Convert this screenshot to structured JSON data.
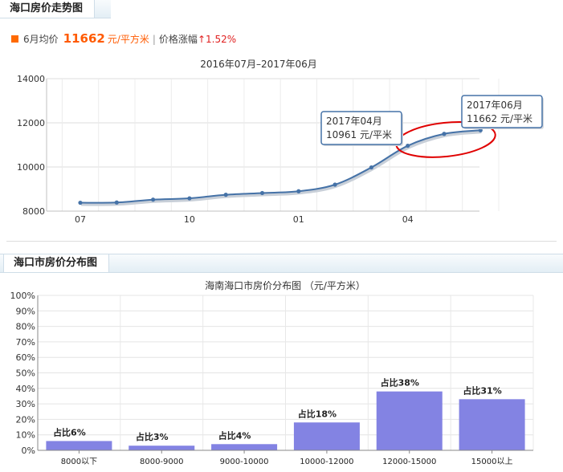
{
  "sections": {
    "trend_title": "海口房价走势图",
    "distribution_title": "海口市房价分布图"
  },
  "summary": {
    "month_label": "6月均价",
    "price": "11662",
    "unit": "元/平方米",
    "separator": "|",
    "change_label": "价格涨幅",
    "change_value": "↑1.52%"
  },
  "colors": {
    "line": "#4572a7",
    "bar": "#8383e3",
    "highlight_circle": "#e00000",
    "accent": "#ff5a00"
  },
  "chart_data": [
    {
      "type": "line",
      "title": "2016年07月–2017年06月",
      "xlabel": "",
      "ylabel": "",
      "x": [
        "2016-07",
        "2016-08",
        "2016-09",
        "2016-10",
        "2016-11",
        "2016-12",
        "2017-01",
        "2017-02",
        "2017-03",
        "2017-04",
        "2017-05",
        "2017-06"
      ],
      "x_tick_labels": [
        "07",
        "10",
        "01",
        "04"
      ],
      "x_tick_positions": [
        0,
        3,
        6,
        9
      ],
      "series": [
        {
          "values": [
            8380,
            8390,
            8520,
            8580,
            8740,
            8820,
            8900,
            9200,
            9980,
            10961,
            11500,
            11662
          ]
        }
      ],
      "ylim": [
        8000,
        14000
      ],
      "y_ticks": [
        8000,
        10000,
        12000,
        14000
      ],
      "grid": true,
      "legend": "none",
      "tooltips": [
        {
          "index": 9,
          "date": "2017年04月",
          "value": "10961 元/平米"
        },
        {
          "index": 11,
          "date": "2017年06月",
          "value": "11662 元/平米"
        }
      ],
      "annotation": "red ellipse around last three points"
    },
    {
      "type": "bar",
      "title": "海南海口市房价分布图 （元/平方米）",
      "xlabel": "",
      "ylabel": "",
      "categories": [
        "8000以下",
        "8000-9000",
        "9000-10000",
        "10000-12000",
        "12000-15000",
        "15000以上"
      ],
      "values": [
        6,
        3,
        4,
        18,
        38,
        33
      ],
      "data_labels": [
        "占比6%",
        "占比3%",
        "占比4%",
        "占比18%",
        "占比38%",
        "占比31%"
      ],
      "ylim": [
        0,
        100
      ],
      "y_ticks": [
        "0%",
        "10%",
        "20%",
        "30%",
        "40%",
        "50%",
        "60%",
        "70%",
        "80%",
        "90%",
        "100%"
      ],
      "grid": true,
      "legend": "none"
    }
  ]
}
